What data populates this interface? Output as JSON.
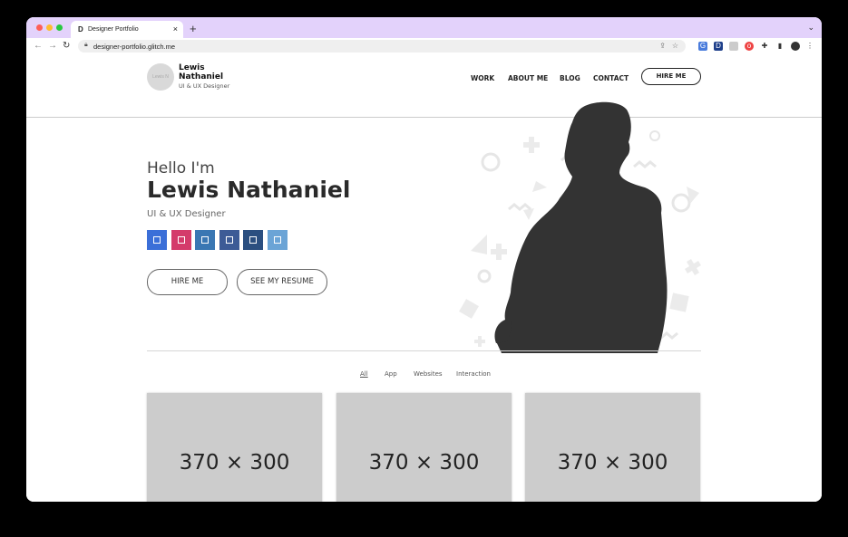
{
  "browser": {
    "tab_title": "Designer Portfolio",
    "tab_favicon": "D",
    "new_tab": "+",
    "close_tab": "×",
    "url": "designer-portfolio.glitch.me"
  },
  "site": {
    "avatar_text": "Lewis N",
    "brand_name": "Lewis Nathaniel",
    "brand_role": "UI & UX Designer",
    "nav": [
      "WORK",
      "ABOUT ME",
      "BLOG",
      "CONTACT"
    ],
    "hire_button": "HIRE ME"
  },
  "hero": {
    "greeting": "Hello I'm",
    "name": "Lewis Nathaniel",
    "role": "UI & UX Designer",
    "social_colors": [
      "#3b6fd8",
      "#d43b6b",
      "#3a77b3",
      "#3d5b96",
      "#2b4f80",
      "#6ba4d6"
    ],
    "hire_button": "HIRE ME",
    "resume_button": "SEE MY RESUME"
  },
  "filters": [
    "All",
    "App",
    "Websites",
    "Interaction"
  ],
  "cards": [
    "370 × 300",
    "370 × 300",
    "370 × 300"
  ]
}
